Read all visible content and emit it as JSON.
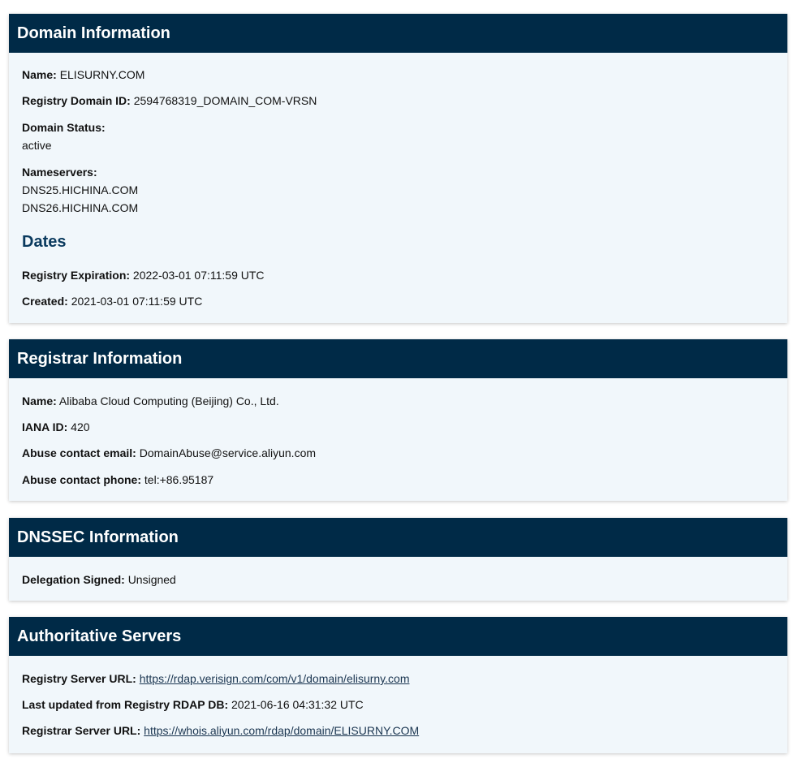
{
  "domain": {
    "title": "Domain Information",
    "name_label": "Name:",
    "name_value": "ELISURNY.COM",
    "registry_id_label": "Registry Domain ID:",
    "registry_id_value": "2594768319_DOMAIN_COM-VRSN",
    "status_label": "Domain Status:",
    "status_value": "active",
    "nameservers_label": "Nameservers:",
    "nameservers": [
      "DNS25.HICHINA.COM",
      "DNS26.HICHINA.COM"
    ],
    "dates_title": "Dates",
    "expiration_label": "Registry Expiration:",
    "expiration_value": "2022-03-01 07:11:59 UTC",
    "created_label": "Created:",
    "created_value": "2021-03-01 07:11:59 UTC"
  },
  "registrar": {
    "title": "Registrar Information",
    "name_label": "Name:",
    "name_value": "Alibaba Cloud Computing (Beijing) Co., Ltd.",
    "iana_label": "IANA ID:",
    "iana_value": "420",
    "abuse_email_label": "Abuse contact email:",
    "abuse_email_value": "DomainAbuse@service.aliyun.com",
    "abuse_phone_label": "Abuse contact phone:",
    "abuse_phone_value": "tel:+86.95187"
  },
  "dnssec": {
    "title": "DNSSEC Information",
    "delegation_label": "Delegation Signed:",
    "delegation_value": "Unsigned"
  },
  "servers": {
    "title": "Authoritative Servers",
    "registry_url_label": "Registry Server URL:",
    "registry_url": "https://rdap.verisign.com/com/v1/domain/elisurny.com",
    "last_updated_label": "Last updated from Registry RDAP DB:",
    "last_updated_value": "2021-06-16 04:31:32 UTC",
    "registrar_url_label": "Registrar Server URL:",
    "registrar_url": "https://whois.aliyun.com/rdap/domain/ELISURNY.COM"
  },
  "colors": {
    "header_bg": "#002a47",
    "card_bg": "#f1f7fb",
    "subhead": "#0a3a5e"
  }
}
